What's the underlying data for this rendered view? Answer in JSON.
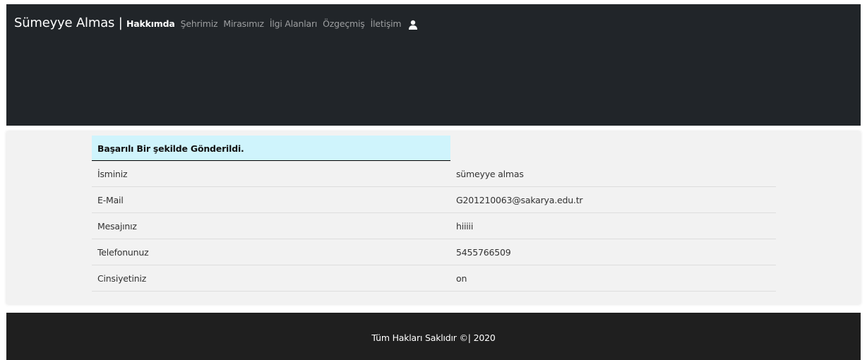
{
  "navbar": {
    "brand": "Sümeyye Almas |",
    "links": [
      {
        "label": "Hakkımda",
        "active": true
      },
      {
        "label": "Şehrimiz",
        "active": false
      },
      {
        "label": "Mirasımız",
        "active": false
      },
      {
        "label": "İlgi Alanları",
        "active": false
      },
      {
        "label": "Özgeçmiş",
        "active": false
      },
      {
        "label": "İletişim",
        "active": false
      }
    ],
    "user_icon": "user-icon"
  },
  "alert": {
    "text": "Başarılı Bir şekilde Gönderildi."
  },
  "table": {
    "rows": [
      {
        "label": "İsminiz",
        "value": "sümeyye almas"
      },
      {
        "label": "E-Mail",
        "value": "G201210063@sakarya.edu.tr"
      },
      {
        "label": "Mesajınız",
        "value": "hiiiii"
      },
      {
        "label": "Telefonunuz",
        "value": "5455766509"
      },
      {
        "label": "Cinsiyetiniz",
        "value": "on"
      }
    ]
  },
  "footer": {
    "text": "Tüm Hakları Saklıdır ©| 2020"
  },
  "colors": {
    "navbar_bg": "#212529",
    "alert_bg": "#cff4fc",
    "content_bg": "#f2f2f2",
    "footer_bg": "#1f1f1f"
  }
}
